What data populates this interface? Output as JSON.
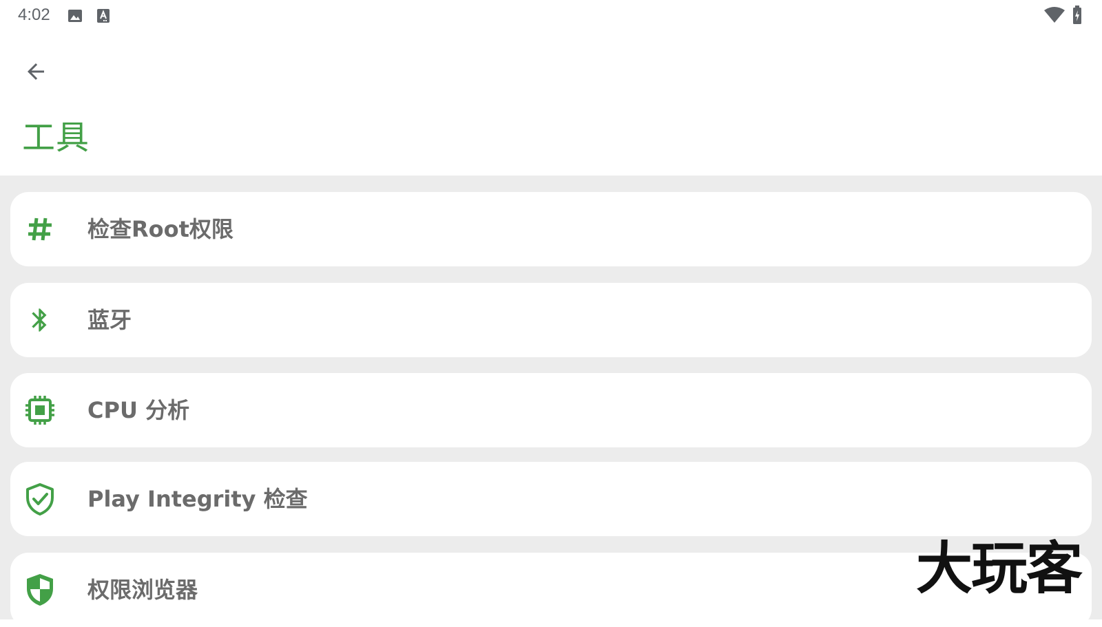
{
  "status_bar": {
    "time": "4:02",
    "icons": [
      "image-notification-icon",
      "keyboard-notification-icon",
      "wifi-icon",
      "battery-charging-icon"
    ]
  },
  "app_bar": {
    "back_icon": "arrow-back-icon",
    "title": "工具"
  },
  "colors": {
    "accent": "#43a047",
    "background": "#ececec",
    "card": "#ffffff",
    "text": "#6b6b6b"
  },
  "tools": [
    {
      "icon": "hash-icon",
      "label": "检查Root权限"
    },
    {
      "icon": "bluetooth-icon",
      "label": "蓝牙"
    },
    {
      "icon": "cpu-icon",
      "label": "CPU 分析"
    },
    {
      "icon": "shield-check-icon",
      "label": "Play Integrity 检查"
    },
    {
      "icon": "security-shield-icon",
      "label": "权限浏览器"
    }
  ],
  "watermark": "大玩客"
}
